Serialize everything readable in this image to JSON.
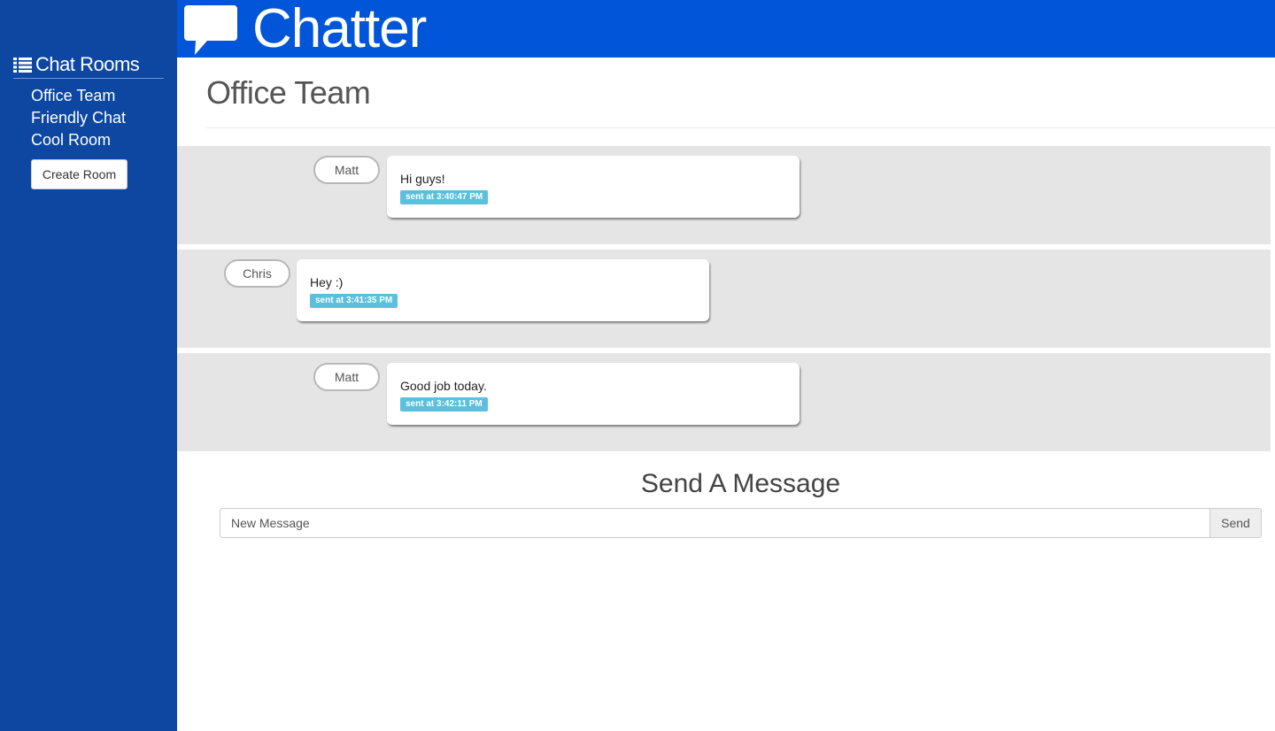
{
  "colors": {
    "sidebar_bg": "#0d47a1",
    "topbar_bg": "#0055d9",
    "message_row_bg": "#e5e5e5",
    "timestamp_badge": "#5bc0de"
  },
  "header": {
    "icon": "speech-bubble-icon",
    "app_name": "Chatter"
  },
  "sidebar": {
    "icon": "list-icon",
    "title": "Chat Rooms",
    "rooms": [
      {
        "label": "Office Team"
      },
      {
        "label": "Friendly Chat"
      },
      {
        "label": "Cool Room"
      }
    ],
    "create_button_label": "Create Room"
  },
  "main": {
    "room_title": "Office Team",
    "messages": [
      {
        "user": "Matt",
        "text": "Hi guys!",
        "timestamp": "sent at 3:40:47 PM"
      },
      {
        "user": "Chris",
        "text": "Hey :)",
        "timestamp": "sent at 3:41:35 PM"
      },
      {
        "user": "Matt",
        "text": "Good job today.",
        "timestamp": "sent at 3:42:11 PM"
      }
    ]
  },
  "composer": {
    "heading": "Send A Message",
    "input_placeholder": "New Message",
    "input_value": "",
    "send_label": "Send"
  }
}
